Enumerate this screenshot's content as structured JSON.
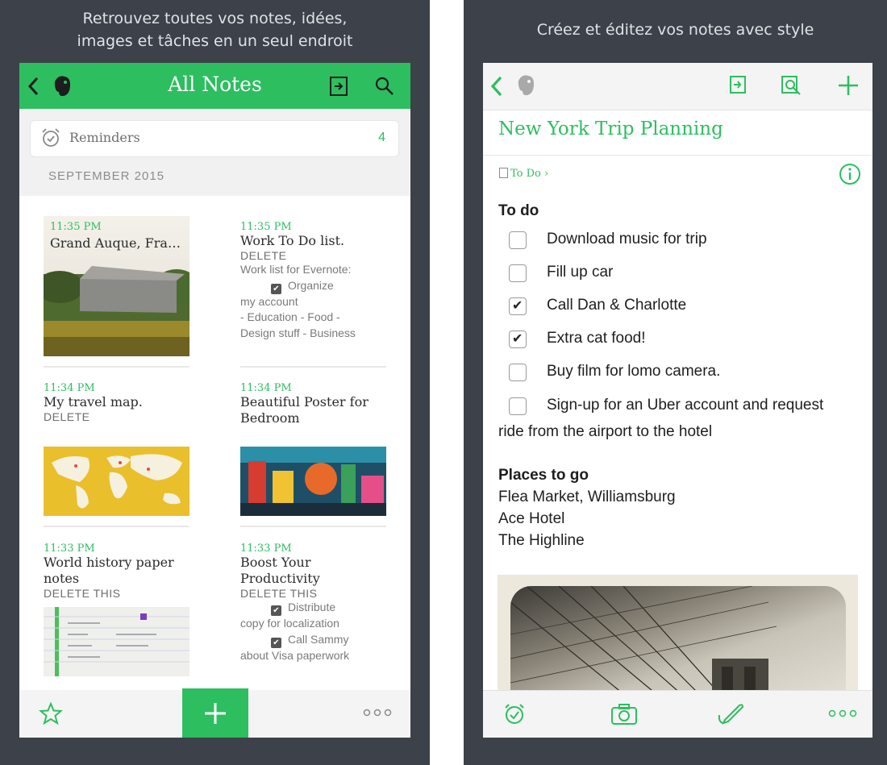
{
  "left": {
    "caption_line1": "Retrouvez toutes vos notes, idées,",
    "caption_line2": "images et tâches en un seul endroit",
    "header": {
      "title": "All Notes",
      "back_icon": "chevron-left-icon",
      "logo_icon": "evernote-elephant-icon",
      "share_icon": "share-icon",
      "search_icon": "search-icon"
    },
    "reminders": {
      "label": "Reminders",
      "count": "4",
      "icon": "alarm-clock-icon"
    },
    "month": "SEPTEMBER 2015",
    "notes": [
      {
        "time": "11:35 PM",
        "title": "Grand Auque, Fra…"
      },
      {
        "time": "11:35 PM",
        "title": "Work To Do list.",
        "delete": "DELETE",
        "body1": "Work list for Evernote:",
        "check1": "Organize",
        "body2": "my account",
        "body3": "- Education - Food -",
        "body4": "Design stuff - Business"
      },
      {
        "time": "11:34 PM",
        "title": "My travel map.",
        "delete": "DELETE"
      },
      {
        "time": "11:34 PM",
        "title1": "Beautiful  Poster for",
        "title2": "Bedroom"
      },
      {
        "time": "11:33 PM",
        "title1": "World history paper",
        "title2": "notes",
        "delete": "DELETE THIS"
      },
      {
        "time": "11:33 PM",
        "title1": "Boost Your",
        "title2": "Productivity",
        "delete": "DELETE THIS",
        "check1": "Distribute",
        "body1": "copy for localization",
        "check2": "Call Sammy",
        "body2": "about Visa paperwork"
      }
    ],
    "footer": {
      "star_icon": "star-icon",
      "add_icon": "plus-icon",
      "more_icon": "more-icon"
    }
  },
  "right": {
    "caption": "Créez et éditez vos notes avec style",
    "header": {
      "back_icon": "chevron-left-icon",
      "logo_icon": "evernote-elephant-icon",
      "share_icon": "share-icon",
      "present_icon": "presentation-icon",
      "add_icon": "plus-icon"
    },
    "note_title": "New York Trip Planning",
    "notebook": "To Do ›",
    "info_icon": "info-icon",
    "todo_heading": "To do",
    "todos": [
      {
        "text": "Download music for trip",
        "checked": false
      },
      {
        "text": "Fill up car",
        "checked": false
      },
      {
        "text": "Call Dan & Charlotte",
        "checked": true
      },
      {
        "text": "Extra cat food!",
        "checked": true
      },
      {
        "text": "Buy film for lomo camera.",
        "checked": false
      },
      {
        "text": "Sign-up for an Uber account and request",
        "checked": false
      }
    ],
    "todo_wrap": "ride from the airport to the hotel",
    "places_heading": "Places to go",
    "places": [
      "Flea Market, Williamsburg",
      "Ace Hotel",
      "The Highline"
    ],
    "footer": {
      "reminder_icon": "alarm-clock-icon",
      "camera_icon": "camera-icon",
      "pen_icon": "pen-icon",
      "more_icon": "more-icon"
    }
  },
  "colors": {
    "accent": "#2dbe60",
    "frame": "#3d4149"
  }
}
